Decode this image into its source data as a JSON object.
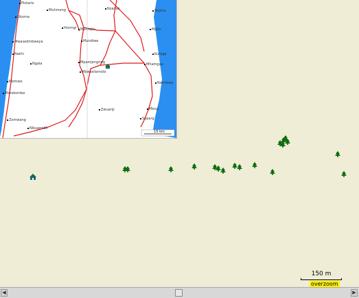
{
  "inset_places": [
    "Pistarie",
    "Likoma",
    "Mwasedmbweya",
    "Rakhi",
    "Ngala",
    "Mbmwe",
    "Marokombe",
    "Zomwang",
    "Nikuamidh",
    "Muhmeng",
    "Hormgi",
    "Nzalnjo",
    "Muntajiu",
    "Mundiwe",
    "Nsjimu",
    "Mpamjengring",
    "Mbwasilamole",
    "Zwuanji",
    "Mjelo",
    "Kuroga",
    "Mhamgaa",
    "Nelmbwe",
    "Mkoyi",
    "Soparg"
  ],
  "inset_scale": "15 km",
  "scale": {
    "label": "150 m",
    "badge": "overzoom"
  },
  "colors": {
    "land": "#efedd6",
    "water": "#2a8ff0",
    "road": "#e01818",
    "tree": "#0b6b0b"
  },
  "icons": {
    "tree": "tree-icon",
    "hut": "hut-icon"
  },
  "scrollbar": {
    "left": "◀",
    "right": "▶"
  }
}
